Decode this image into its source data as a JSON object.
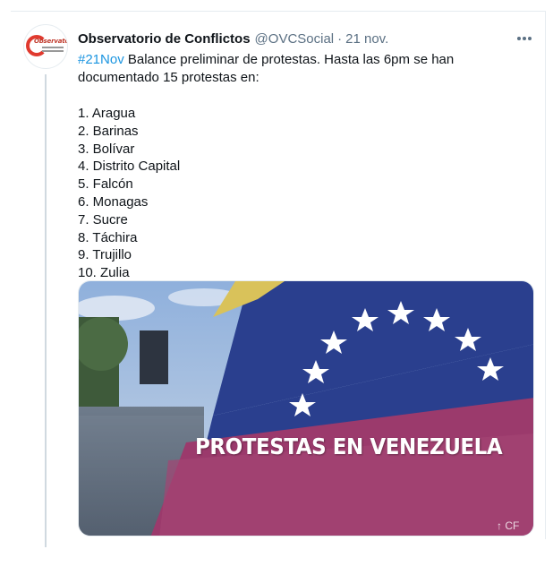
{
  "account": {
    "display_name": "Observatorio de Conflictos",
    "handle": "@OVCSocial",
    "separator": "·",
    "timestamp": "21 nov.",
    "avatar_icon": "ovc-logo-icon",
    "avatar_logo_text": "Observatorio"
  },
  "tweet": {
    "hashtag": "#21Nov",
    "intro": " Balance preliminar de protestas. Hasta las 6pm se han documentado 15 protestas en:",
    "items": [
      "1. Aragua",
      "2. Barinas",
      "3. Bolívar",
      "4. Distrito Capital",
      "5. Falcón",
      "6. Monagas",
      "7. Sucre",
      "8. Táchira",
      "9. Trujillo",
      "10. Zulia"
    ]
  },
  "media": {
    "caption": "PROTESTAS EN VENEZUELA",
    "corner_text": "↑ CF",
    "colors": {
      "flag_yellow": "#d9c25a",
      "flag_blue": "#2a3f8e",
      "flag_red": "#9b3a6c",
      "sky": "#9fb6d6"
    }
  },
  "more_icon": "more-horizontal-icon",
  "colors": {
    "link": "#1b95e0",
    "secondary_text": "#5b7083"
  }
}
